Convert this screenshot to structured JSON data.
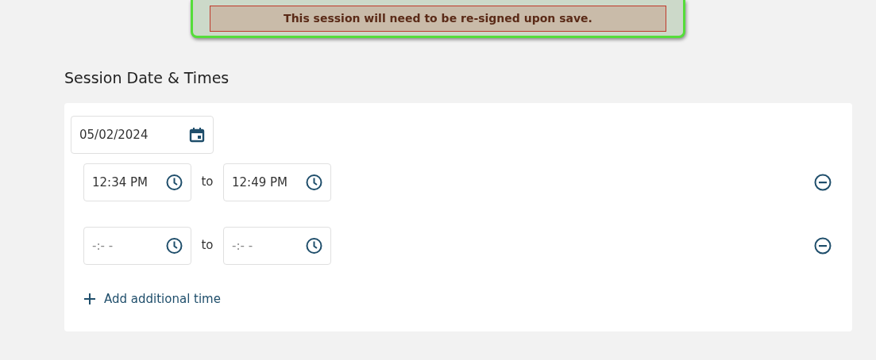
{
  "banner": {
    "message": "This session will need to be re-signed upon save."
  },
  "section": {
    "title": "Session Date & Times"
  },
  "date": {
    "value": "05/02/2024"
  },
  "times": [
    {
      "start": {
        "value": "12:34 PM"
      },
      "separator": "to",
      "end": {
        "value": "12:49 PM"
      }
    },
    {
      "start": {
        "placeholder": "-:- -"
      },
      "separator": "to",
      "end": {
        "placeholder": "-:- -"
      }
    }
  ],
  "add_button": {
    "label": "Add additional time"
  }
}
